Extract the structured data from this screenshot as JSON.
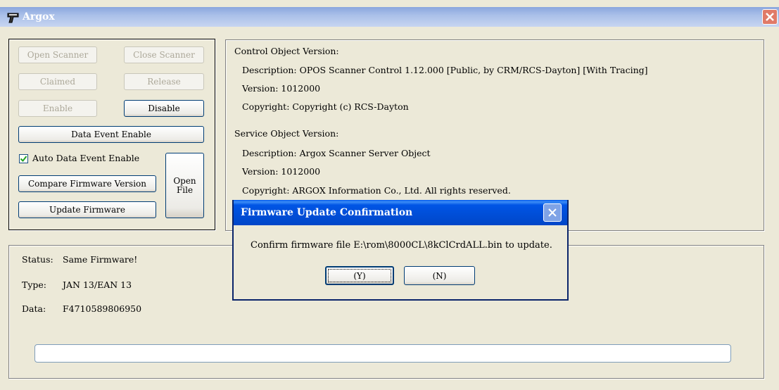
{
  "window": {
    "title": "Argox",
    "close_icon": "close-x-icon",
    "app_icon": "scanner-gun-icon"
  },
  "buttons": {
    "open_scanner": "Open Scanner",
    "close_scanner": "Close Scanner",
    "claimed": "Claimed",
    "release": "Release",
    "enable": "Enable",
    "disable": "Disable",
    "data_event_enable": "Data Event Enable",
    "compare_firmware": "Compare Firmware Version",
    "update_firmware": "Update Firmware",
    "open_file_line1": "Open",
    "open_file_line2": "File"
  },
  "auto_data_event": {
    "label": "Auto Data Event Enable",
    "checked": true
  },
  "control_object": {
    "heading": "Control Object Version:",
    "description": "Description:  OPOS Scanner Control 1.12.000 [Public, by CRM/RCS-Dayton] [With Tracing]",
    "version": "Version:  1012000",
    "copyright": "Copyright:  Copyright (c) RCS-Dayton"
  },
  "service_object": {
    "heading": "Service Object Version:",
    "description": "Description:    Argox Scanner Server Object",
    "version": "Version:    1012000",
    "copyright": "Copyright:   ARGOX Information Co., Ltd.  All rights reserved."
  },
  "status_panel": {
    "status_label": "Status:",
    "status_value": "Same Firmware!",
    "type_label": "Type:",
    "type_value": "JAN 13/EAN 13",
    "data_label": "Data:",
    "data_value": "F4710589806950",
    "progress_percent": 0
  },
  "dialog": {
    "title": "Firmware Update Confirmation",
    "message": "Confirm firmware file E:\\rom\\8000CL\\8kClCrdALL.bin to update.",
    "yes_label": "(Y)",
    "no_label": "(N)"
  },
  "colors": {
    "dialog_title": "#0054e3",
    "window_bg": "#ece9d8",
    "close_red": "#e07a68"
  }
}
